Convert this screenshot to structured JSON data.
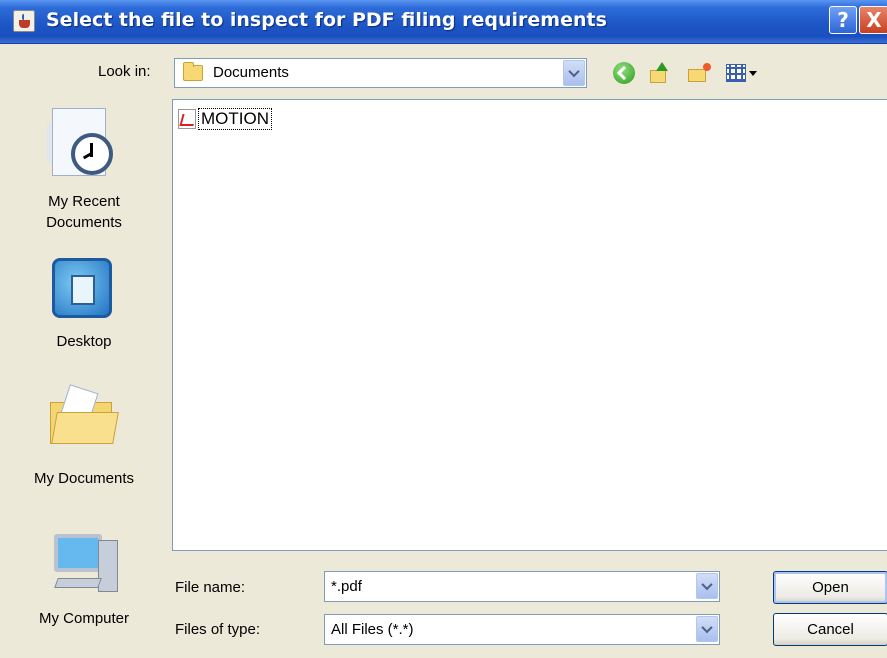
{
  "window": {
    "title": "Select the file to inspect for PDF filing requirements",
    "help_label": "?",
    "close_label": "X"
  },
  "lookin": {
    "label": "Look in:",
    "value": "Documents"
  },
  "toolbar": {
    "icons": [
      "back-icon",
      "up-one-level-icon",
      "new-folder-icon",
      "view-menu-icon"
    ]
  },
  "places": [
    {
      "label": "My Recent\nDocuments",
      "icon": "recent-documents-icon"
    },
    {
      "label": "Desktop",
      "icon": "desktop-icon"
    },
    {
      "label": "My Documents",
      "icon": "my-documents-icon"
    },
    {
      "label": "My Computer",
      "icon": "my-computer-icon"
    }
  ],
  "files": [
    {
      "name": "MOTION",
      "icon": "pdf-file-icon"
    }
  ],
  "filename": {
    "label": "File name:",
    "value": "*.pdf"
  },
  "filetype": {
    "label": "Files of type:",
    "value": "All Files (*.*)"
  },
  "buttons": {
    "open": "Open",
    "cancel": "Cancel"
  },
  "colors": {
    "titlebar": "#1e57c7",
    "dialog_bg": "#ece9d8",
    "field_border": "#7f9db9"
  }
}
